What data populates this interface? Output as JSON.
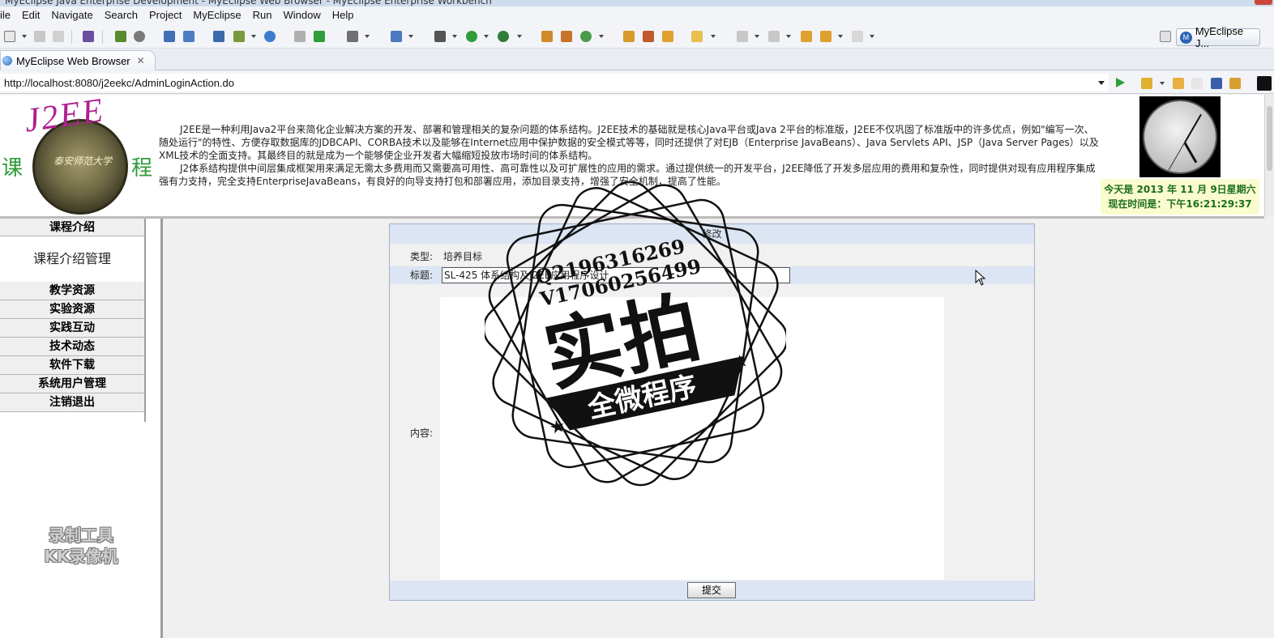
{
  "window": {
    "title": "MyEclipse Java Enterprise Development - MyEclipse Web Browser - MyEclipse Enterprise Workbench"
  },
  "menubar": {
    "items": [
      "ile",
      "Edit",
      "Navigate",
      "Search",
      "Project",
      "MyEclipse",
      "Run",
      "Window",
      "Help"
    ]
  },
  "toolbar": {
    "perspective_label": "MyEclipse J...",
    "perspective_icon_letter": "M"
  },
  "editor_tab": {
    "label": "MyEclipse Web Browser",
    "close": "✕"
  },
  "browser": {
    "url": "http://localhost:8080/j2eekc/AdminLoginAction.do"
  },
  "banner": {
    "logo_title": "J2EE",
    "logo_left": "课",
    "logo_right": "程",
    "seal_text": "泰安师范大学",
    "intro_p1": "J2EE是一种利用Java2平台来简化企业解决方案的开发、部署和管理相关的复杂问题的体系结构。J2EE技术的基础就是核心Java平台或Java 2平台的标准版，J2EE不仅巩固了标准版中的许多优点，例如\"编写一次、随处运行\"的特性、方便存取数据库的JDBCAPI、CORBA技术以及能够在Internet应用中保护数据的安全模式等等，同时还提供了对EJB（Enterprise JavaBeans）、Java Servlets API、JSP（Java Server Pages）以及XML技术的全面支持。其最终目的就是成为一个能够使企业开发者大幅缩短投放市场时间的体系结构。",
    "intro_p2": "J2体系结构提供中间层集成框架用来满足无需太多费用而又需要高可用性、高可靠性以及可扩展性的应用的需求。通过提供统一的开发平台，J2EE降低了开发多层应用的费用和复杂性，同时提供对现有应用程序集成强有力支持，完全支持EnterpriseJavaBeans，有良好的向导支持打包和部署应用，添加目录支持，增强了安全机制，提高了性能。",
    "date_line": "今天是 2013 年 11 月 9日星期六",
    "time_line": "现在时间是：下午16:21:29:37"
  },
  "nav": {
    "section_title": "课程介绍",
    "sub_item": "课程介绍管理",
    "items": [
      "教学资源",
      "实验资源",
      "实践互动",
      "技术动态",
      "软件下载",
      "系统用户管理",
      "注销退出"
    ]
  },
  "recorder_watermark": {
    "line1": "录制工具",
    "line2": "KK录像机"
  },
  "form": {
    "header": "修改",
    "type_label": "类型:",
    "type_value": "培养目标",
    "title_label": "标题:",
    "title_value": "SL-425 体系结构及J2EE应用程序设计",
    "content_label": "内容:",
    "submit_label": "提交"
  },
  "stamp": {
    "line1": "Q2196316269",
    "line2": "V17060256499",
    "main": "实拍",
    "ribbon": "全微程序"
  }
}
